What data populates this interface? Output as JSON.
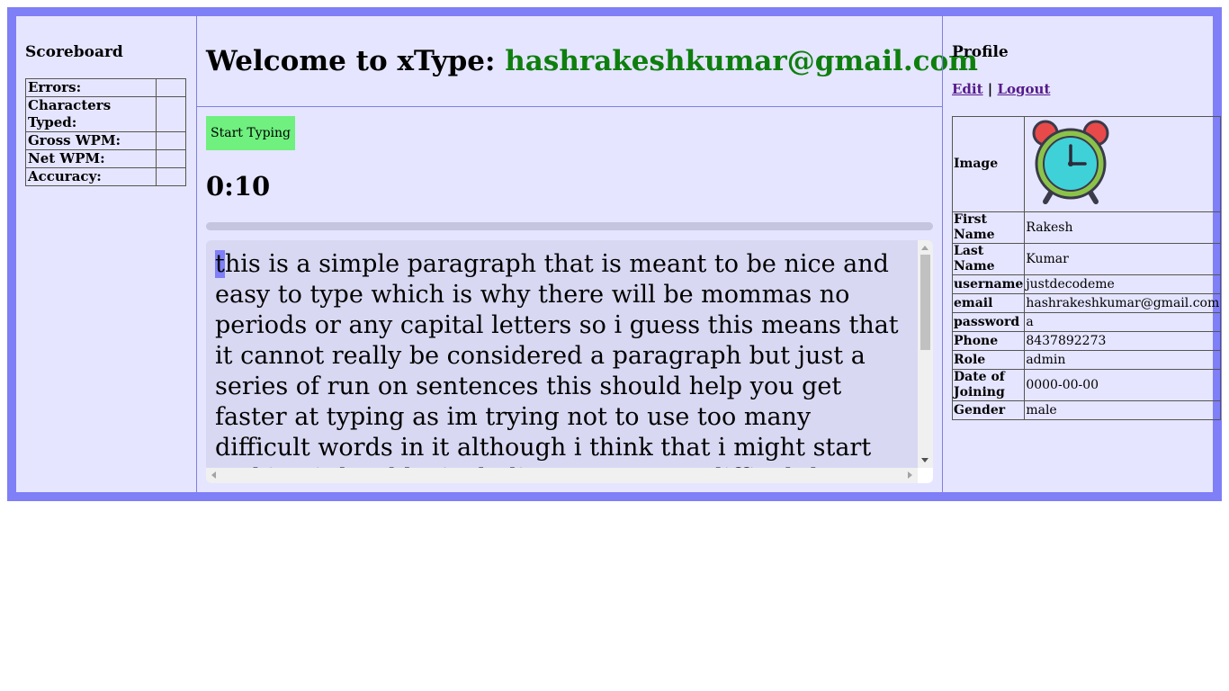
{
  "scoreboard": {
    "title": "Scoreboard",
    "rows": [
      {
        "label": "Errors:",
        "value": ""
      },
      {
        "label": "Characters Typed:",
        "value": ""
      },
      {
        "label": "Gross WPM:",
        "value": ""
      },
      {
        "label": "Net WPM:",
        "value": ""
      },
      {
        "label": "Accuracy:",
        "value": ""
      }
    ]
  },
  "header": {
    "welcome": "Welcome to xType:",
    "email": "hashrakeshkumar@gmail.com"
  },
  "typing": {
    "start_label": "Start Typing",
    "timer": "0:10",
    "progress": 0,
    "cursor_char": "t",
    "text_rest": "his is a simple paragraph that is meant to be nice and easy to type which is why there will be mommas no periods or any capital letters so i guess this means that it cannot really be considered a paragraph but just a series of run on sentences this should help you get faster at typing as im trying not to use too many difficult words in it although i think that i might start making it hard by including some more difficult letters I'm"
  },
  "profile": {
    "title": "Profile",
    "edit": "Edit",
    "separator": "|",
    "logout": "Logout",
    "image_label": "Image",
    "image_icon": "alarm-clock-icon",
    "fields": [
      {
        "label": "First Name",
        "value": "Rakesh"
      },
      {
        "label": "Last Name",
        "value": "Kumar"
      },
      {
        "label": "username",
        "value": "justdecodeme"
      },
      {
        "label": "email",
        "value": "hashrakeshkumar@gmail.com"
      },
      {
        "label": "password",
        "value": "a"
      },
      {
        "label": "Phone",
        "value": "8437892273"
      },
      {
        "label": "Role",
        "value": "admin"
      },
      {
        "label": "Date of Joining",
        "value": "0000-00-00"
      },
      {
        "label": "Gender",
        "value": "male"
      }
    ]
  },
  "colors": {
    "frame": "#7f7ff7",
    "panel": "#e5e5ff",
    "email_green": "#0e7f0e",
    "button_green": "#6ff07f"
  }
}
